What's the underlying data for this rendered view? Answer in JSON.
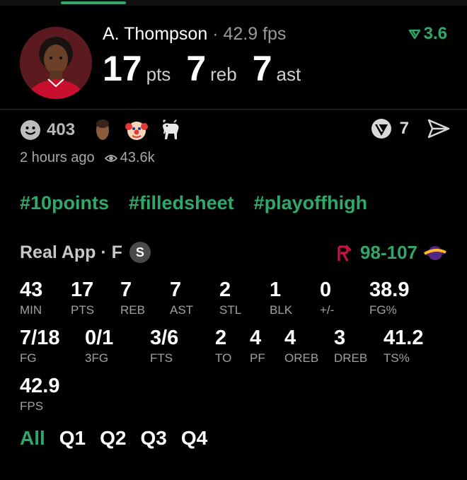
{
  "player": {
    "name": "A. Thompson",
    "separator": "·",
    "fps_text": "42.9 fps",
    "trend_value": "3.6",
    "statline": [
      {
        "value": "17",
        "unit": "pts"
      },
      {
        "value": "7",
        "unit": "reb"
      },
      {
        "value": "7",
        "unit": "ast"
      }
    ]
  },
  "reactions": {
    "count": "403",
    "comment_count": "7"
  },
  "meta": {
    "time_ago": "2 hours ago",
    "views": "43.6k"
  },
  "hashtags": [
    "#10points",
    "#filledsheet",
    "#playoffhigh"
  ],
  "game": {
    "source": "Real App · F",
    "badge": "S",
    "score_home": "98",
    "score_sep": "-",
    "score_away": "107"
  },
  "box_score": {
    "row1": [
      {
        "value": "43",
        "label": "MIN"
      },
      {
        "value": "17",
        "label": "PTS"
      },
      {
        "value": "7",
        "label": "REB"
      },
      {
        "value": "7",
        "label": "AST"
      },
      {
        "value": "2",
        "label": "STL"
      },
      {
        "value": "1",
        "label": "BLK"
      },
      {
        "value": "0",
        "label": "+/-"
      },
      {
        "value": "38.9",
        "label": "FG%"
      }
    ],
    "row2": [
      {
        "value": "7/18",
        "label": "FG"
      },
      {
        "value": "0/1",
        "label": "3FG"
      },
      {
        "value": "3/6",
        "label": "FTS"
      },
      {
        "value": "2",
        "label": "TO"
      },
      {
        "value": "4",
        "label": "PF"
      },
      {
        "value": "4",
        "label": "OREB"
      },
      {
        "value": "3",
        "label": "DREB"
      },
      {
        "value": "41.2",
        "label": "TS%"
      }
    ],
    "row3": [
      {
        "value": "42.9",
        "label": "FPS"
      }
    ]
  },
  "quarters": [
    "All",
    "Q1",
    "Q2",
    "Q3",
    "Q4"
  ],
  "colors": {
    "accent": "#2fa86a",
    "background": "#000000",
    "muted": "#a0a0a0",
    "rockets_red": "#ce1141",
    "lakers_gold": "#fdb927"
  }
}
